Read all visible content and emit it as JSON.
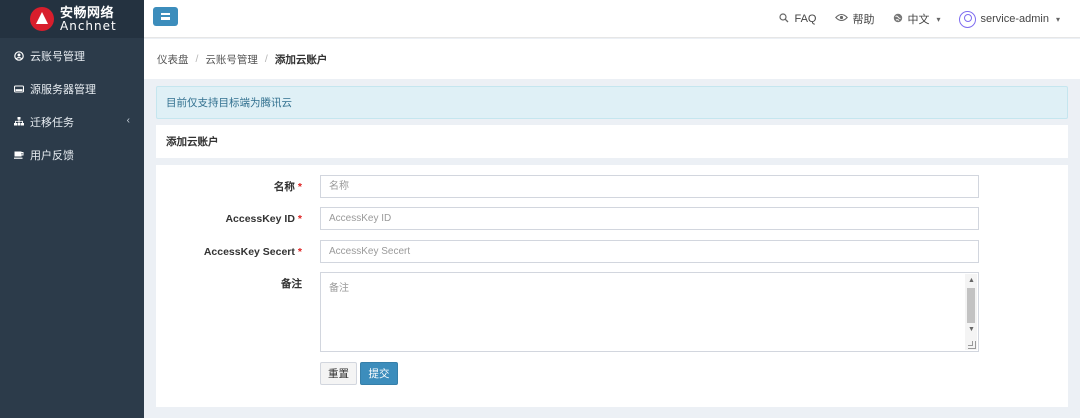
{
  "brand": {
    "name_cn": "安畅网络",
    "name_en": "Anchnet"
  },
  "sidebar": {
    "items": [
      {
        "label": "云账号管理",
        "icon": "user-circle-icon"
      },
      {
        "label": "源服务器管理",
        "icon": "hdd-icon"
      },
      {
        "label": "迁移任务",
        "icon": "sitemap-icon",
        "has_submenu": true
      },
      {
        "label": "用户反馈",
        "icon": "coffee-icon"
      }
    ]
  },
  "topbar": {
    "faq_label": "FAQ",
    "help_label": "帮助",
    "language_label": "中文",
    "user_label": "service-admin"
  },
  "breadcrumb": {
    "items": [
      "仪表盘",
      "云账号管理",
      "添加云账户"
    ]
  },
  "alert": {
    "text": "目前仅支持目标端为腾讯云"
  },
  "panel": {
    "title": "添加云账户"
  },
  "form": {
    "name": {
      "label": "名称",
      "placeholder": "名称",
      "required": true
    },
    "access_key_id": {
      "label": "AccessKey ID",
      "placeholder": "AccessKey ID",
      "required": true
    },
    "access_key_secret": {
      "label": "AccessKey Secert",
      "placeholder": "AccessKey Secert",
      "required": true
    },
    "remark": {
      "label": "备注",
      "placeholder": "备注",
      "required": false
    },
    "reset_label": "重置",
    "submit_label": "提交"
  },
  "colors": {
    "primary": "#3c8dbc",
    "sidebar_bg": "#2c3b4a",
    "required": "#dd2222",
    "alert_bg": "#dff0f6"
  }
}
